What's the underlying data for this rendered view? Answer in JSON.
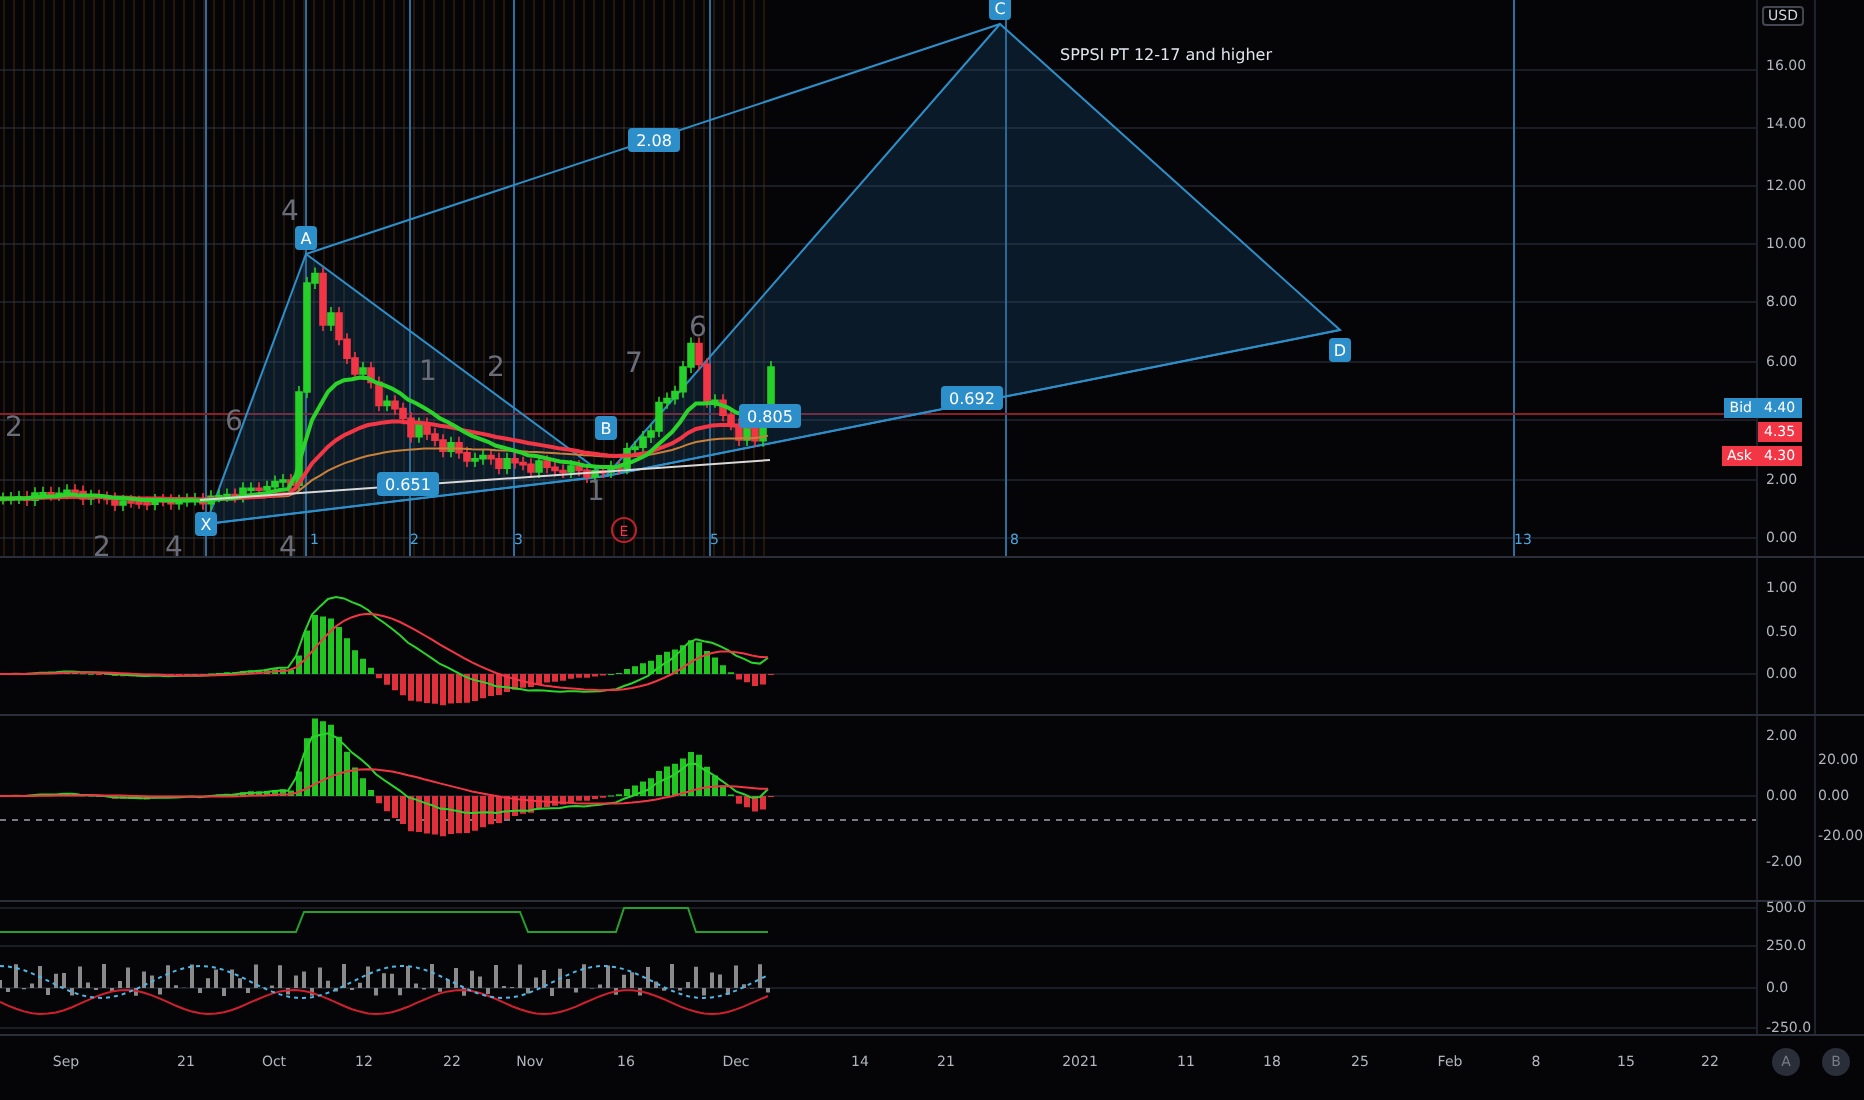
{
  "main_chart": {
    "annotation": "SPPSI PT 12-17 and higher",
    "pattern_points": [
      "X",
      "A",
      "B",
      "C",
      "D"
    ],
    "ratios": [
      "2.08",
      "0.651",
      "0.692",
      "0.805"
    ],
    "wave_counts": [
      "2",
      "6",
      "4",
      "1",
      "2",
      "7",
      "6",
      "1",
      "2",
      "4",
      "4"
    ],
    "time_zones": [
      "1",
      "2",
      "3",
      "5",
      "8",
      "13"
    ],
    "event_marker": "E"
  },
  "price_axis": {
    "currency": "USD",
    "ticks": [
      "16.00",
      "14.00",
      "12.00",
      "10.00",
      "8.00",
      "6.00",
      "2.00",
      "0.00"
    ],
    "bid": {
      "label": "Bid",
      "value": "4.40"
    },
    "last": "4.35",
    "ask": {
      "label": "Ask",
      "value": "4.30"
    }
  },
  "panes": [
    {
      "ticks": [
        "1.00",
        "0.50",
        "0.00"
      ]
    },
    {
      "ticks": [
        "2.00",
        "0.00",
        "-2.00"
      ],
      "secondary_ticks": [
        "20.00",
        "0.00",
        "-20.00"
      ]
    },
    {
      "ticks": [
        "500.0",
        "250.0",
        "0.0",
        "-250.0"
      ]
    }
  ],
  "time_axis": {
    "labels": [
      "Sep",
      "21",
      "Oct",
      "12",
      "22",
      "Nov",
      "16",
      "Dec",
      "14",
      "21",
      "2021",
      "11",
      "18",
      "25",
      "Feb",
      "8",
      "15",
      "22"
    ]
  },
  "scale_buttons": [
    "A",
    "B"
  ]
}
